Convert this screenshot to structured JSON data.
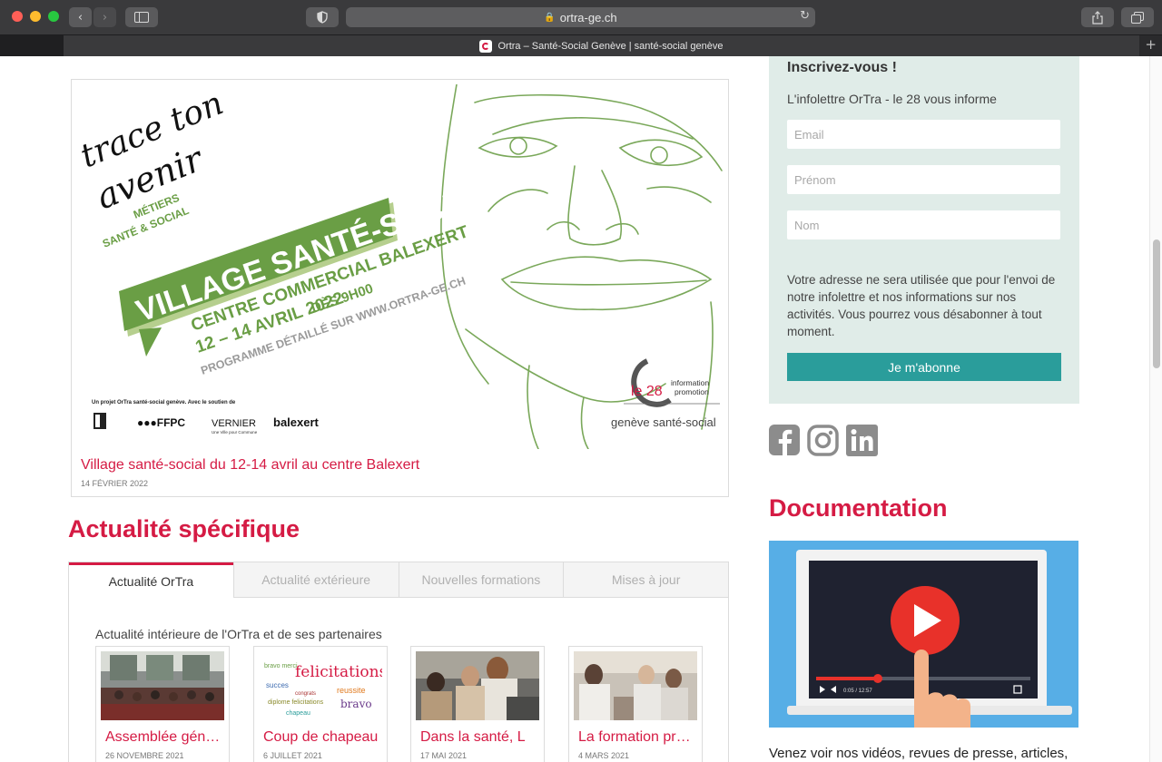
{
  "browser": {
    "url": "ortra-ge.ch",
    "tab_title": "Ortra – Santé-Social Genève | santé-social genève"
  },
  "hero": {
    "title": "Village santé-social du 12-14 avril au centre Balexert",
    "date": "14 FÉVRIER 2022",
    "poster": {
      "script_line1": "trace ton",
      "script_line2": "avenir",
      "metiers": "MÉTIERS",
      "sante_social": "SANTÉ & SOCIAL",
      "banner": "VILLAGE SANTÉ-SOCIAL",
      "line1": "CENTRE COMMERCIAL BALEXERT",
      "line2": "12 – 14 AVRIL 2022",
      "line2b": "DÈS 9H00",
      "line3": "PROGRAMME DÉTAILLÉ SUR WWW.ORTRA-GE.CH",
      "support": "Un projet OrTra santé-social genève. Avec le soutien de",
      "logos": [
        "●●●FFPC",
        "VERNIER",
        "balexert"
      ],
      "vernier_sub": "Une Ville pour Commune",
      "le28": "le 28",
      "le28_tag1": "information",
      "le28_tag2": "promotion",
      "brand": "genève santé-social"
    }
  },
  "actualite": {
    "heading": "Actualité spécifique",
    "tabs": [
      "Actualité OrTra",
      "Actualité extérieure",
      "Nouvelles formations",
      "Mises à jour"
    ],
    "subtitle": "Actualité intérieure de l'OrTra et de ses partenaires",
    "cards": [
      {
        "title": "Assemblée générale",
        "date": "26 NOVEMBRE 2021"
      },
      {
        "title": "Coup de chapeau",
        "date": "6 JUILLET 2021"
      },
      {
        "title": "Dans la santé, L",
        "date": "17 MAI 2021"
      },
      {
        "title": "La formation pratique",
        "date": "4 MARS 2021"
      }
    ]
  },
  "newsletter": {
    "title": "Inscrivez-vous !",
    "subtitle": "L'infolettre OrTra - le 28 vous informe",
    "email_placeholder": "Email",
    "prenom_placeholder": "Prénom",
    "nom_placeholder": "Nom",
    "note": "Votre adresse ne sera utilisée que pour l'envoi de notre infolettre et nos informations sur nos activités. Vous pourrez vous désabonner à tout moment.",
    "button": "Je m'abonne"
  },
  "social": [
    "facebook-icon",
    "instagram-icon",
    "linkedin-icon"
  ],
  "documentation": {
    "heading": "Documentation",
    "video_time": "0:05 / 12:57",
    "text": "Venez voir nos vidéos, revues de presse, articles,"
  },
  "colors": {
    "accent": "#d51b44",
    "teal": "#2a9d9b",
    "newsletter_bg": "#e0ece8",
    "poster_green": "#6a9e45"
  }
}
